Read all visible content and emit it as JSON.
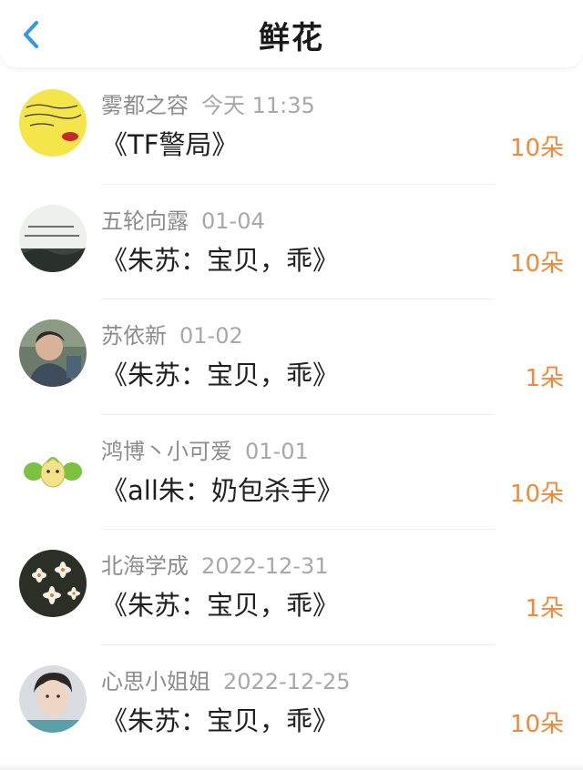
{
  "header": {
    "title": "鲜花",
    "back_icon": "chevron-left-icon",
    "accent": "#2f9be0"
  },
  "colors": {
    "count": "#f0893a",
    "username": "#8c8c8c",
    "date": "#a8a8a8",
    "work_title": "#1f1f1f"
  },
  "items": [
    {
      "user": "雾都之容",
      "date": "今天 11:35",
      "work": "《TF警局》",
      "count": "10朵",
      "avatar": "yellow-note-avatar"
    },
    {
      "user": "五轮向露",
      "date": "01-04",
      "work": "《朱苏：宝贝，乖》",
      "count": "10朵",
      "avatar": "calligraphy-avatar"
    },
    {
      "user": "苏依新",
      "date": "01-02",
      "work": "《朱苏：宝贝，乖》",
      "count": "1朵",
      "avatar": "portrait-avatar"
    },
    {
      "user": "鸿博丶小可爱",
      "date": "01-01",
      "work": "《all朱：奶包杀手》",
      "count": "10朵",
      "avatar": "cartoon-sprout-avatar"
    },
    {
      "user": "北海学成",
      "date": "2022-12-31",
      "work": "《朱苏：宝贝，乖》",
      "count": "1朵",
      "avatar": "flowers-avatar"
    },
    {
      "user": "心思小姐姐",
      "date": "2022-12-25",
      "work": "《朱苏：宝贝，乖》",
      "count": "10朵",
      "avatar": "person-avatar"
    }
  ]
}
